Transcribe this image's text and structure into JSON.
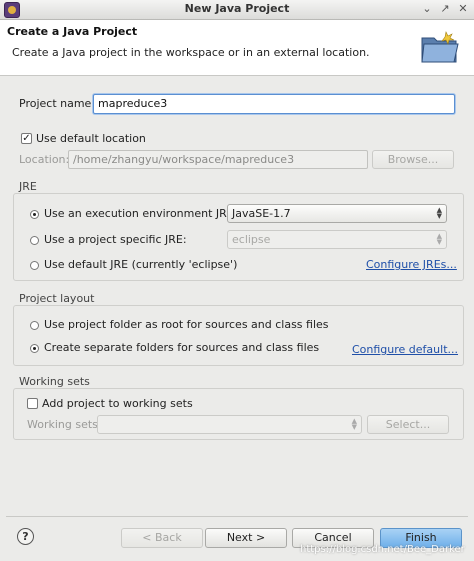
{
  "window": {
    "title": "New Java Project",
    "controls": [
      "⌄",
      "↗",
      "✕"
    ]
  },
  "header": {
    "title": "Create a Java Project",
    "description": "Create a Java project in the workspace or in an external location.",
    "icon": "new-folder-icon"
  },
  "project": {
    "name_label": "Project name:",
    "name_value": "mapreduce3",
    "default_location_label": "Use default location",
    "default_location_checked": true,
    "location_label": "Location:",
    "location_value": "/home/zhangyu/workspace/mapreduce3",
    "browse_label": "Browse..."
  },
  "jre": {
    "group_title": "JRE",
    "options": [
      {
        "label": "Use an execution environment JRE:",
        "selected": true,
        "combo_value": "JavaSE-1.7"
      },
      {
        "label": "Use a project specific JRE:",
        "selected": false,
        "combo_value": "eclipse"
      },
      {
        "label": "Use default JRE (currently 'eclipse')",
        "selected": false
      }
    ],
    "configure_link": "Configure JREs..."
  },
  "layout": {
    "group_title": "Project layout",
    "options": [
      {
        "label": "Use project folder as root for sources and class files",
        "selected": false
      },
      {
        "label": "Create separate folders for sources and class files",
        "selected": true
      }
    ],
    "configure_link": "Configure default..."
  },
  "working_sets": {
    "group_title": "Working sets",
    "add_label": "Add project to working sets",
    "add_checked": false,
    "sets_label": "Working sets:",
    "sets_value": "",
    "select_label": "Select..."
  },
  "footer": {
    "help_glyph": "?",
    "back_label": "< Back",
    "next_label": "Next >",
    "cancel_label": "Cancel",
    "finish_label": "Finish",
    "watermark": "https://blog.csdn.net/Bee_Darker"
  }
}
